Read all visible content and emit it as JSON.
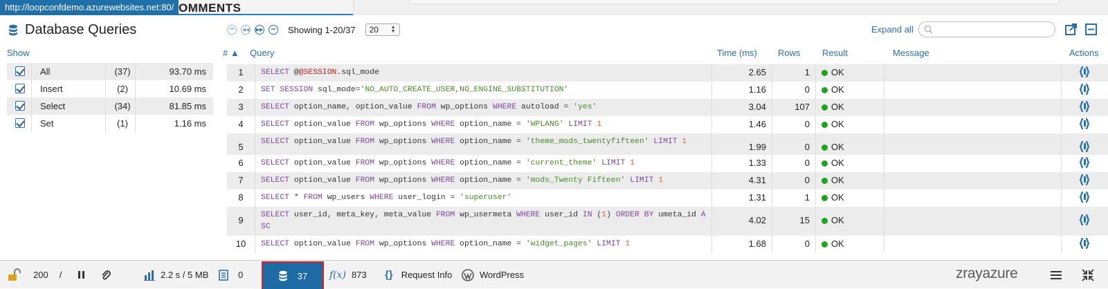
{
  "browser": {
    "url_tooltip": "http://loopconfdemo.azurewebsites.net:80/",
    "background_heading": "OMMENTS"
  },
  "panel": {
    "title": "Database Queries",
    "showing": "Showing 1-20/37",
    "page_size": "20",
    "expand_all": "Expand all",
    "search_placeholder": ""
  },
  "columns": {
    "show": "Show",
    "num": "# ▲",
    "query": "Query",
    "time": "Time (ms)",
    "rows": "Rows",
    "result": "Result",
    "message": "Message",
    "actions": "Actions"
  },
  "filters": [
    {
      "label": "All",
      "count": "(37)",
      "time": "93.70 ms",
      "checked": true
    },
    {
      "label": "Insert",
      "count": "(2)",
      "time": "10.69 ms",
      "checked": true
    },
    {
      "label": "Select",
      "count": "(34)",
      "time": "81.85 ms",
      "checked": true
    },
    {
      "label": "Set",
      "count": "(1)",
      "time": "1.16 ms",
      "checked": true
    }
  ],
  "queries": [
    {
      "num": "1",
      "time": "2.65",
      "rows": "1",
      "result": "OK",
      "sql": [
        [
          "kw",
          "SELECT "
        ],
        [
          "t",
          "@"
        ],
        [
          "var",
          "@SESSION"
        ],
        [
          "t",
          ".sql_mode"
        ]
      ]
    },
    {
      "num": "2",
      "time": "1.16",
      "rows": "0",
      "result": "OK",
      "sql": [
        [
          "kw",
          "SET SESSION "
        ],
        [
          "t",
          "sql_mode="
        ],
        [
          "str",
          "'NO_AUTO_CREATE_USER,NO_ENGINE_SUBSTITUTION'"
        ]
      ]
    },
    {
      "num": "3",
      "time": "3.04",
      "rows": "107",
      "result": "OK",
      "sql": [
        [
          "kw",
          "SELECT "
        ],
        [
          "t",
          "option_name, option_value "
        ],
        [
          "kw",
          "FROM "
        ],
        [
          "t",
          "wp_options "
        ],
        [
          "kw",
          "WHERE "
        ],
        [
          "t",
          "autoload = "
        ],
        [
          "str",
          "'yes'"
        ]
      ]
    },
    {
      "num": "4",
      "time": "1.46",
      "rows": "0",
      "result": "OK",
      "sql": [
        [
          "kw",
          "SELECT "
        ],
        [
          "t",
          "option_value "
        ],
        [
          "kw",
          "FROM "
        ],
        [
          "t",
          "wp_options "
        ],
        [
          "kw",
          "WHERE "
        ],
        [
          "t",
          "option_name = "
        ],
        [
          "str",
          "'WPLANG' "
        ],
        [
          "kw",
          "LIMIT "
        ],
        [
          "num",
          "1"
        ]
      ]
    },
    {
      "num": "5",
      "time": "1.99",
      "rows": "0",
      "result": "OK",
      "sql": [
        [
          "kw",
          "SELECT "
        ],
        [
          "t",
          "option_value "
        ],
        [
          "kw",
          "FROM "
        ],
        [
          "t",
          "wp_options "
        ],
        [
          "kw",
          "WHERE "
        ],
        [
          "t",
          "option_name = "
        ],
        [
          "str",
          "'theme_mods_twentyfifteen' "
        ],
        [
          "kw",
          "LIMIT "
        ],
        [
          "num",
          "1"
        ]
      ]
    },
    {
      "num": "6",
      "time": "1.33",
      "rows": "0",
      "result": "OK",
      "sql": [
        [
          "kw",
          "SELECT "
        ],
        [
          "t",
          "option_value "
        ],
        [
          "kw",
          "FROM "
        ],
        [
          "t",
          "wp_options "
        ],
        [
          "kw",
          "WHERE "
        ],
        [
          "t",
          "option_name = "
        ],
        [
          "str",
          "'current_theme' "
        ],
        [
          "kw",
          "LIMIT "
        ],
        [
          "num",
          "1"
        ]
      ]
    },
    {
      "num": "7",
      "time": "4.31",
      "rows": "0",
      "result": "OK",
      "sql": [
        [
          "kw",
          "SELECT "
        ],
        [
          "t",
          "option_value "
        ],
        [
          "kw",
          "FROM "
        ],
        [
          "t",
          "wp_options "
        ],
        [
          "kw",
          "WHERE "
        ],
        [
          "t",
          "option_name = "
        ],
        [
          "str",
          "'mods_Twenty Fifteen' "
        ],
        [
          "kw",
          "LIMIT "
        ],
        [
          "num",
          "1"
        ]
      ]
    },
    {
      "num": "8",
      "time": "1.31",
      "rows": "1",
      "result": "OK",
      "sql": [
        [
          "kw",
          "SELECT "
        ],
        [
          "t",
          "* "
        ],
        [
          "kw",
          "FROM "
        ],
        [
          "t",
          "wp_users "
        ],
        [
          "kw",
          "WHERE "
        ],
        [
          "t",
          "user_login = "
        ],
        [
          "str",
          "'superuser'"
        ]
      ]
    },
    {
      "num": "9",
      "time": "4.02",
      "rows": "15",
      "result": "OK",
      "sql": [
        [
          "kw",
          "SELECT "
        ],
        [
          "t",
          "user_id, meta_key, meta_value "
        ],
        [
          "kw",
          "FROM "
        ],
        [
          "t",
          "wp_usermeta "
        ],
        [
          "kw",
          "WHERE "
        ],
        [
          "t",
          "user_id "
        ],
        [
          "kw",
          "IN "
        ],
        [
          "t",
          "("
        ],
        [
          "num",
          "1"
        ],
        [
          "t",
          ") "
        ],
        [
          "kw",
          "ORDER BY "
        ],
        [
          "t",
          "umeta_id "
        ],
        [
          "kw",
          "ASC"
        ]
      ]
    },
    {
      "num": "10",
      "time": "1.68",
      "rows": "0",
      "result": "OK",
      "sql": [
        [
          "kw",
          "SELECT "
        ],
        [
          "t",
          "option_value "
        ],
        [
          "kw",
          "FROM "
        ],
        [
          "t",
          "wp_options "
        ],
        [
          "kw",
          "WHERE "
        ],
        [
          "t",
          "option_name = "
        ],
        [
          "str",
          "'widget_pages' "
        ],
        [
          "kw",
          "LIMIT "
        ],
        [
          "num",
          "1"
        ]
      ]
    }
  ],
  "toolbar": {
    "status_code": "200",
    "status_sep": "/",
    "time_memory": "2.2 s / 5 MB",
    "logs_count": "0",
    "db_queries": "37",
    "functions_count": "873",
    "request_info": "Request Info",
    "wordpress": "WordPress",
    "brand": "zrayazure"
  },
  "colors": {
    "accent": "#1e6aa5",
    "link": "#2a6fa8",
    "ok": "#1ca51c",
    "highlight_border": "#e02020"
  }
}
